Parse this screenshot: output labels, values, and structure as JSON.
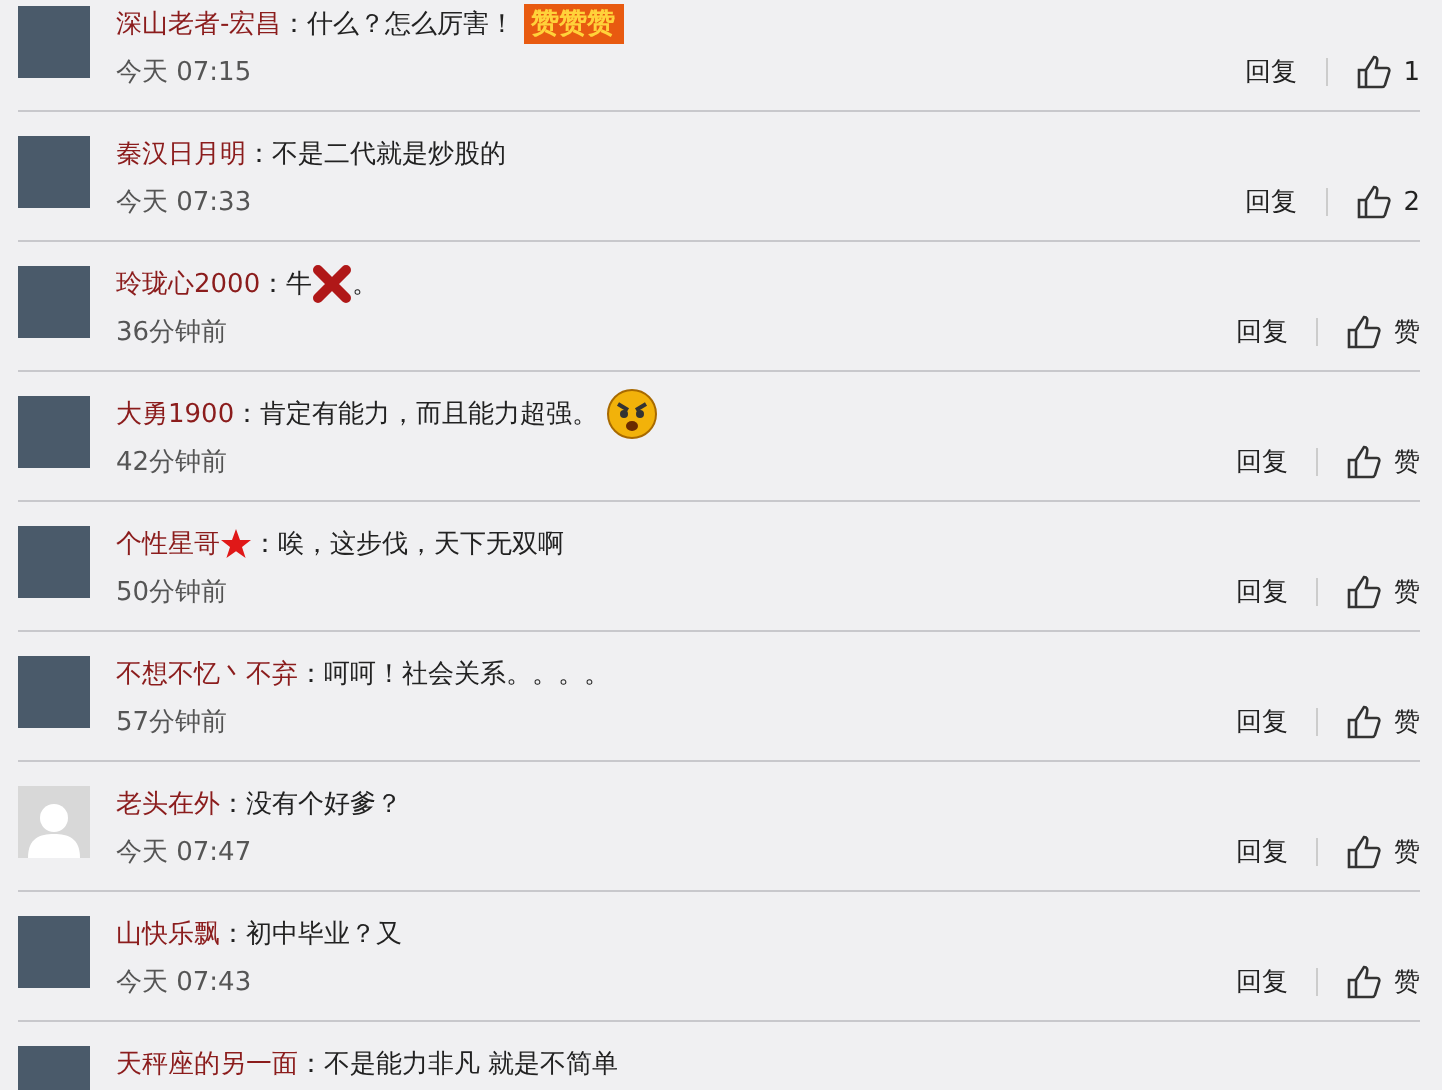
{
  "comments": [
    {
      "default_avatar": false,
      "user": "深山老者-宏昌",
      "starred": false,
      "separator": "：",
      "content": [
        {
          "kind": "text",
          "text": "什么？怎么厉害！"
        },
        {
          "kind": "sticker",
          "text": "赞赞赞"
        }
      ],
      "time": "今天 07:15",
      "reply": "回复",
      "like": "1"
    },
    {
      "default_avatar": false,
      "user": "秦汉日月明",
      "starred": false,
      "separator": "：",
      "content": [
        {
          "kind": "text",
          "text": "不是二代就是炒股的"
        }
      ],
      "time": "今天 07:33",
      "reply": "回复",
      "like": "2"
    },
    {
      "default_avatar": false,
      "user": "玲珑心2000",
      "starred": false,
      "separator": "：",
      "content": [
        {
          "kind": "text",
          "text": "牛"
        },
        {
          "kind": "cross"
        },
        {
          "kind": "text",
          "text": "。"
        }
      ],
      "time": "36分钟前",
      "reply": "回复",
      "like": "赞"
    },
    {
      "default_avatar": false,
      "user": "大勇1900",
      "starred": false,
      "separator": "：",
      "content": [
        {
          "kind": "text",
          "text": "肯定有能力，而且能力超强。"
        },
        {
          "kind": "angry"
        }
      ],
      "time": "42分钟前",
      "reply": "回复",
      "like": "赞"
    },
    {
      "default_avatar": false,
      "user": "个性星哥",
      "starred": true,
      "separator": "：",
      "content": [
        {
          "kind": "text",
          "text": "唉，这步伐，天下无双啊"
        }
      ],
      "time": "50分钟前",
      "reply": "回复",
      "like": "赞"
    },
    {
      "default_avatar": false,
      "user": "不想不忆丶不弃",
      "starred": false,
      "separator": "：",
      "content": [
        {
          "kind": "text",
          "text": "呵呵！社会关系。。。。"
        }
      ],
      "time": "57分钟前",
      "reply": "回复",
      "like": "赞"
    },
    {
      "default_avatar": true,
      "user": "老头在外",
      "starred": false,
      "separator": "：",
      "content": [
        {
          "kind": "text",
          "text": "没有个好爹？"
        }
      ],
      "time": "今天 07:47",
      "reply": "回复",
      "like": "赞"
    },
    {
      "default_avatar": false,
      "user": "山快乐飘",
      "starred": false,
      "separator": "：",
      "content": [
        {
          "kind": "text",
          "text": "初中毕业？又"
        }
      ],
      "time": "今天 07:43",
      "reply": "回复",
      "like": "赞"
    },
    {
      "default_avatar": false,
      "user": "天秤座的另一面",
      "starred": false,
      "separator": "：",
      "content": [
        {
          "kind": "text",
          "text": "不是能力非凡 就是不简单"
        }
      ]
    }
  ]
}
